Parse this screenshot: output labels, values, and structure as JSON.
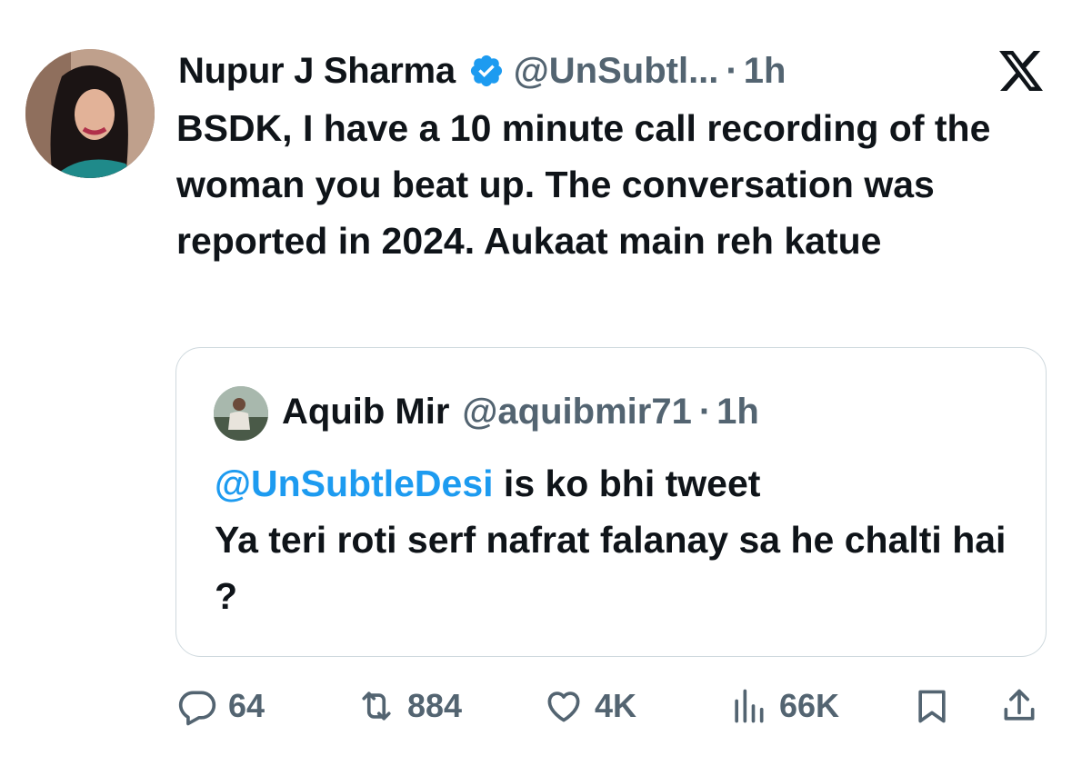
{
  "author": {
    "name": "Nupur J Sharma",
    "handle": "@UnSubtl...",
    "separator": "·",
    "time": "1h"
  },
  "tweet": {
    "text": "BSDK, I have a 10 minute call recording of the woman you beat up. The conversation was reported in 2024. Aukaat main reh katue"
  },
  "quoted": {
    "name": "Aquib Mir",
    "handle": "@aquibmir71",
    "separator": "·",
    "time": "1h",
    "mention": "@UnSubtleDesi",
    "text_after_mention": " is ko bhi tweet",
    "text_line2": "Ya teri roti serf nafrat falanay sa he chalti hai ?"
  },
  "actions": {
    "replies": "64",
    "reposts": "884",
    "likes": "4K",
    "views": "66K"
  },
  "icons": [
    "verified-badge-icon",
    "x-logo-icon",
    "reply-icon",
    "repost-icon",
    "like-icon",
    "views-icon",
    "bookmark-icon",
    "share-icon"
  ],
  "colors": {
    "text": "#0f1419",
    "secondary": "#536471",
    "accent": "#1d9bf0",
    "border": "#cfd9de"
  }
}
